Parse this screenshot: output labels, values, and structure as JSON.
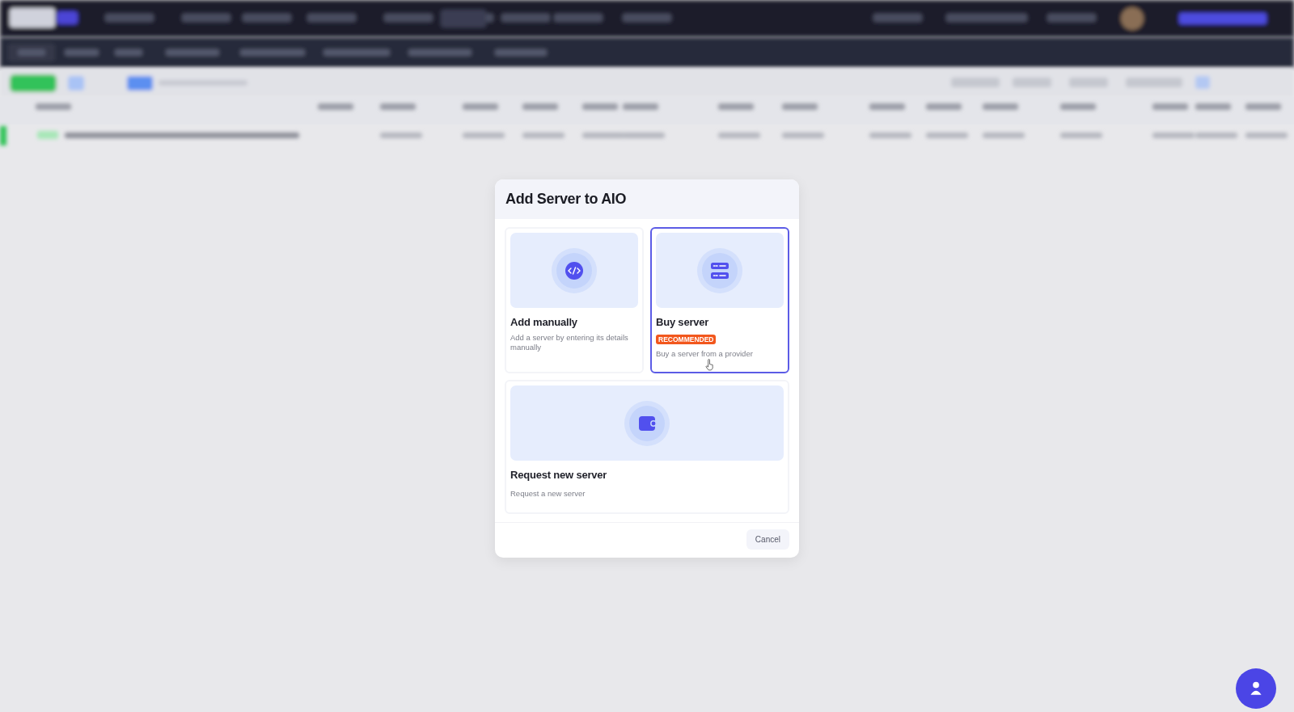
{
  "dialog": {
    "title": "Add Server to AIO",
    "options": [
      {
        "title": "Add manually",
        "description": "Add a server by entering its details manually",
        "selected": false
      },
      {
        "title": "Buy server",
        "badge": "RECOMMENDED",
        "description": "Buy a server from a provider",
        "selected": true
      },
      {
        "title": "Request new server",
        "description": "Request a new server",
        "selected": false
      }
    ],
    "buttons": [
      {
        "label": "Cancel"
      }
    ]
  }
}
